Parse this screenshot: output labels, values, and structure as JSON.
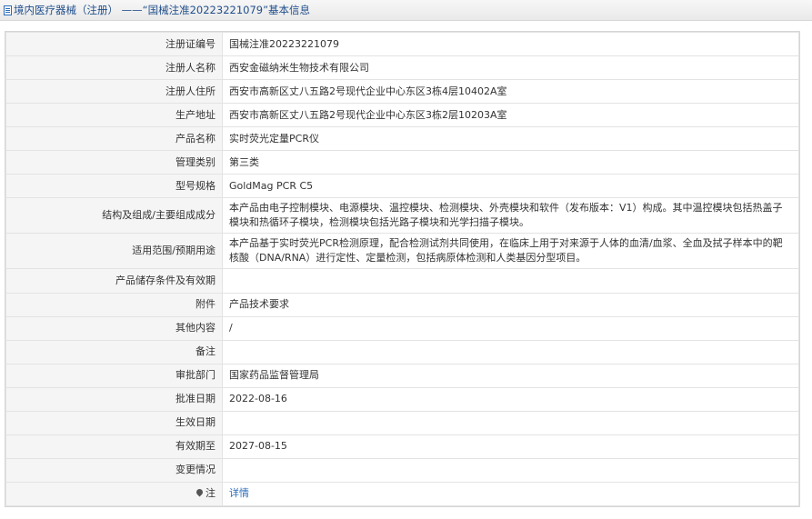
{
  "header": {
    "title": "境内医疗器械（注册） ——“国械注准20223221079”基本信息"
  },
  "rows": [
    {
      "label": "注册证编号",
      "value": "国械注准20223221079"
    },
    {
      "label": "注册人名称",
      "value": "西安金磁纳米生物技术有限公司"
    },
    {
      "label": "注册人住所",
      "value": "西安市高新区丈八五路2号现代企业中心东区3栋4层10402A室"
    },
    {
      "label": "生产地址",
      "value": "西安市高新区丈八五路2号现代企业中心东区3栋2层10203A室"
    },
    {
      "label": "产品名称",
      "value": "实时荧光定量PCR仪"
    },
    {
      "label": "管理类别",
      "value": "第三类"
    },
    {
      "label": "型号规格",
      "value": "GoldMag PCR C5"
    },
    {
      "label": "结构及组成/主要组成成分",
      "value": "本产品由电子控制模块、电源模块、温控模块、检测模块、外壳模块和软件（发布版本：V1）构成。其中温控模块包括热盖子模块和热循环子模块，检测模块包括光路子模块和光学扫描子模块。"
    },
    {
      "label": "适用范围/预期用途",
      "value": "本产品基于实时荧光PCR检测原理，配合检测试剂共同使用，在临床上用于对来源于人体的血清/血浆、全血及拭子样本中的靶核酸（DNA/RNA）进行定性、定量检测，包括病原体检测和人类基因分型项目。"
    },
    {
      "label": "产品储存条件及有效期",
      "value": ""
    },
    {
      "label": "附件",
      "value": "产品技术要求"
    },
    {
      "label": "其他内容",
      "value": "/"
    },
    {
      "label": "备注",
      "value": ""
    },
    {
      "label": "审批部门",
      "value": "国家药品监督管理局"
    },
    {
      "label": "批准日期",
      "value": "2022-08-16"
    },
    {
      "label": "生效日期",
      "value": ""
    },
    {
      "label": "有效期至",
      "value": "2027-08-15"
    },
    {
      "label": "变更情况",
      "value": ""
    },
    {
      "label": "注",
      "value": "详情"
    }
  ]
}
